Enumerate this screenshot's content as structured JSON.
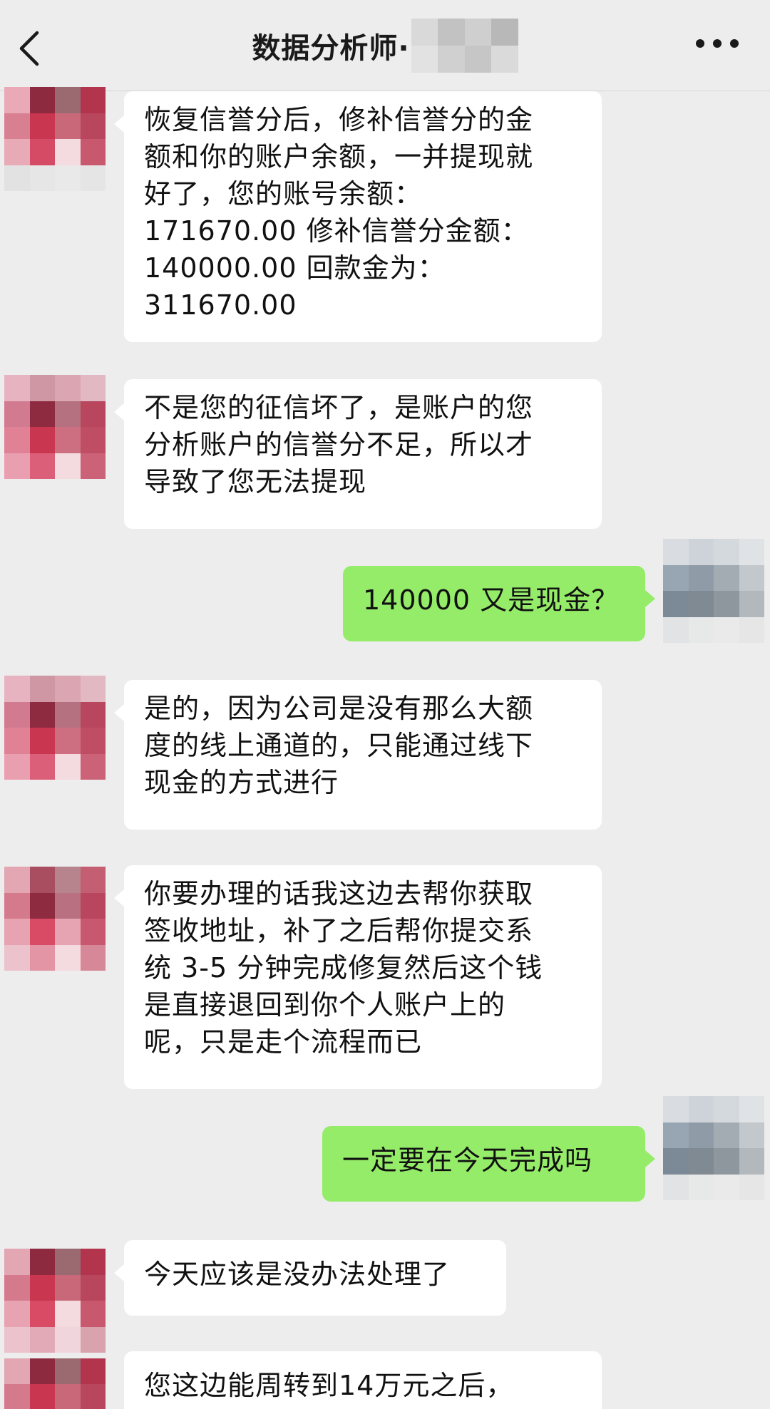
{
  "header": {
    "title": "数据分析师·",
    "back_icon": "chevron-left-icon",
    "more_icon": "more-horizontal-icon"
  },
  "messages": [
    {
      "side": "left",
      "text": "恢复信誉分后，修补信誉分的金\n额和你的账户余额，一并提现就\n好了，您的账号余额：\n171670.00 修补信誉分金额：\n140000.00 回款金为：\n311670.00"
    },
    {
      "side": "left",
      "text": "不是您的征信坏了，是账户的您\n分析账户的信誉分不足，所以才\n导致了您无法提现"
    },
    {
      "side": "right",
      "text": "140000 又是现金？"
    },
    {
      "side": "left",
      "text": "是的，因为公司是没有那么大额\n度的线上通道的，只能通过线下\n现金的方式进行"
    },
    {
      "side": "left",
      "text": "你要办理的话我这边去帮你获取\n签收地址，补了之后帮你提交系\n统 3-5 分钟完成修复然后这个钱\n是直接退回到你个人账户上的\n呢，只是走个流程而已"
    },
    {
      "side": "right",
      "text": "一定要在今天完成吗"
    },
    {
      "side": "left",
      "text": "今天应该是没办法处理了"
    },
    {
      "side": "left",
      "text": "您这边能周转到14万元之后，"
    }
  ],
  "colors": {
    "background": "#ededed",
    "bubble_left": "#ffffff",
    "bubble_right": "#95ec69"
  }
}
